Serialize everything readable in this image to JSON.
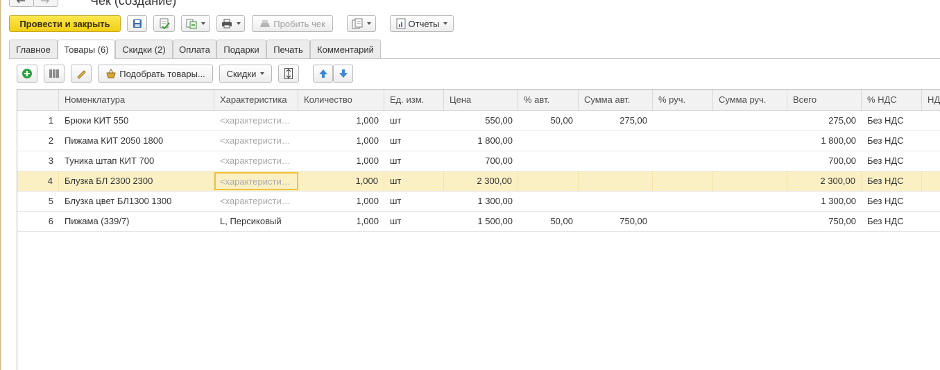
{
  "window": {
    "title": "Чек (создание)"
  },
  "toolbar": {
    "post_and_close": "Провести и закрыть",
    "punch_receipt": "Пробить чек",
    "reports": "Отчеты"
  },
  "tabs": [
    {
      "label": "Главное"
    },
    {
      "label": "Товары (6)"
    },
    {
      "label": "Скидки (2)"
    },
    {
      "label": "Оплата"
    },
    {
      "label": "Подарки"
    },
    {
      "label": "Печать"
    },
    {
      "label": "Комментарий"
    }
  ],
  "table_toolbar": {
    "pick_goods": "Подобрать товары...",
    "discounts": "Скидки"
  },
  "table": {
    "columns": [
      "Номенклатура",
      "Характеристика",
      "Количество",
      "Ед. изм.",
      "Цена",
      "% авт.",
      "Сумма авт.",
      "% руч.",
      "Сумма руч.",
      "Всего",
      "% НДС",
      "НДС"
    ],
    "rows": [
      {
        "n": "1",
        "name": "Брюки КИТ 550",
        "char": "<характеристика>",
        "qty": "1,000",
        "unit": "шт",
        "price": "550,00",
        "auto_pct": "50,00",
        "auto_sum": "275,00",
        "man_pct": "",
        "man_sum": "",
        "total": "275,00",
        "vat": "Без НДС"
      },
      {
        "n": "2",
        "name": "Пижама КИТ 2050 1800",
        "char": "<характеристика>",
        "qty": "1,000",
        "unit": "шт",
        "price": "1 800,00",
        "auto_pct": "",
        "auto_sum": "",
        "man_pct": "",
        "man_sum": "",
        "total": "1 800,00",
        "vat": "Без НДС"
      },
      {
        "n": "3",
        "name": "Туника штап КИТ 700",
        "char": "<характеристика>",
        "qty": "1,000",
        "unit": "шт",
        "price": "700,00",
        "auto_pct": "",
        "auto_sum": "",
        "man_pct": "",
        "man_sum": "",
        "total": "700,00",
        "vat": "Без НДС"
      },
      {
        "n": "4",
        "name": "Блузка БЛ 2300 2300",
        "char": "<характеристика>",
        "qty": "1,000",
        "unit": "шт",
        "price": "2 300,00",
        "auto_pct": "",
        "auto_sum": "",
        "man_pct": "",
        "man_sum": "",
        "total": "2 300,00",
        "vat": "Без НДС"
      },
      {
        "n": "5",
        "name": "Блузка цвет БЛ1300 1300",
        "char": "<характеристика>",
        "qty": "1,000",
        "unit": "шт",
        "price": "1 300,00",
        "auto_pct": "",
        "auto_sum": "",
        "man_pct": "",
        "man_sum": "",
        "total": "1 300,00",
        "vat": "Без НДС"
      },
      {
        "n": "6",
        "name": "Пижама (339/7)",
        "char": "L, Персиковый",
        "qty": "1,000",
        "unit": "шт",
        "price": "1 500,00",
        "auto_pct": "50,00",
        "auto_sum": "750,00",
        "man_pct": "",
        "man_sum": "",
        "total": "750,00",
        "vat": "Без НДС"
      }
    ]
  },
  "colors": {
    "primary_button": "#f2cf17",
    "selected_row": "#fbf0c4",
    "focus_border": "#f0c33c"
  }
}
